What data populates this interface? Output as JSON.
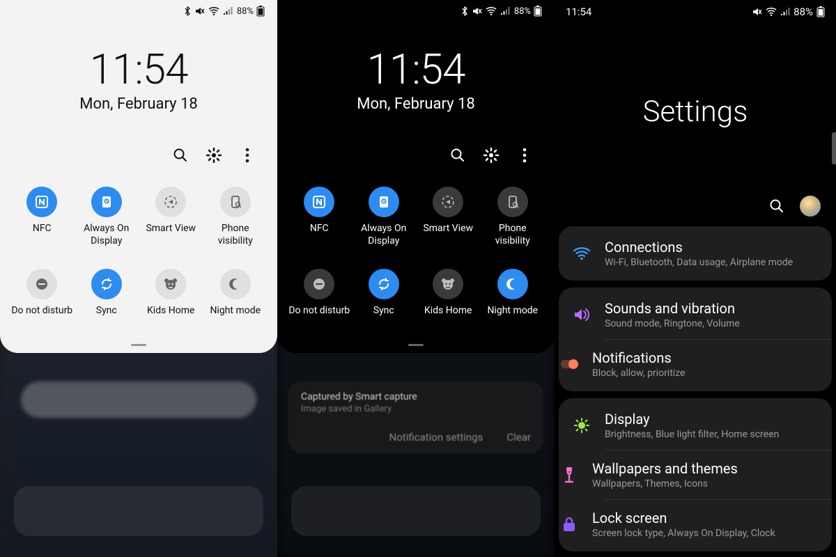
{
  "status": {
    "time": "11:54",
    "battery_pct": "88%",
    "bluetooth": true,
    "muted": true,
    "wifi": true,
    "signal": true
  },
  "clock": {
    "time": "11:54",
    "date": "Mon, February 18"
  },
  "quick_panel": {
    "actions": {
      "search": "Search",
      "settings": "Settings",
      "more": "More"
    },
    "toggles_light": [
      {
        "id": "nfc",
        "label": "NFC",
        "on": true
      },
      {
        "id": "aod",
        "label": "Always On Display",
        "on": true
      },
      {
        "id": "smartview",
        "label": "Smart View",
        "on": false
      },
      {
        "id": "phonevis",
        "label": "Phone visibility",
        "on": false
      },
      {
        "id": "dnd",
        "label": "Do not disturb",
        "on": false
      },
      {
        "id": "sync",
        "label": "Sync",
        "on": true
      },
      {
        "id": "kids",
        "label": "Kids Home",
        "on": false
      },
      {
        "id": "night",
        "label": "Night mode",
        "on": false
      }
    ],
    "toggles_dark": [
      {
        "id": "nfc",
        "label": "NFC",
        "on": true
      },
      {
        "id": "aod",
        "label": "Always On Display",
        "on": true
      },
      {
        "id": "smartview",
        "label": "Smart View",
        "on": false
      },
      {
        "id": "phonevis",
        "label": "Phone visibility",
        "on": false
      },
      {
        "id": "dnd",
        "label": "Do not disturb",
        "on": false
      },
      {
        "id": "sync",
        "label": "Sync",
        "on": true
      },
      {
        "id": "kids",
        "label": "Kids Home",
        "on": false
      },
      {
        "id": "night",
        "label": "Night mode",
        "on": true
      }
    ]
  },
  "notification": {
    "heading": "Captured by Smart capture",
    "sub": "Image saved in Gallery",
    "action_settings": "Notification settings",
    "action_clear": "Clear"
  },
  "settings": {
    "title": "Settings",
    "groups": [
      [
        {
          "icon": "wifi",
          "color": "#3aa0ff",
          "title": "Connections",
          "sub": "Wi-Fi, Bluetooth, Data usage, Airplane mode"
        }
      ],
      [
        {
          "icon": "sound",
          "color": "#b66eff",
          "title": "Sounds and vibration",
          "sub": "Sound mode, Ringtone, Volume"
        },
        {
          "icon": "notif",
          "color": "#ff7d62",
          "title": "Notifications",
          "sub": "Block, allow, prioritize"
        }
      ],
      [
        {
          "icon": "display",
          "color": "#9ee84a",
          "title": "Display",
          "sub": "Brightness, Blue light filter, Home screen"
        },
        {
          "icon": "wall",
          "color": "#ff6ed1",
          "title": "Wallpapers and themes",
          "sub": "Wallpapers, Themes, Icons"
        },
        {
          "icon": "lock",
          "color": "#8c5cff",
          "title": "Lock screen",
          "sub": "Screen lock type, Always On Display, Clock"
        }
      ]
    ]
  }
}
